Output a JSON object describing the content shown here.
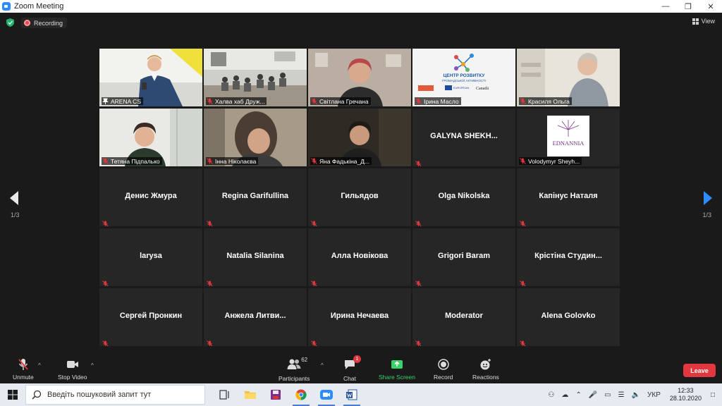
{
  "window": {
    "title": "Zoom Meeting",
    "minimize": "—",
    "restore": "❐",
    "close": "✕"
  },
  "meeting": {
    "recording_label": "Recording",
    "view_label": "View",
    "page_indicator": "1/3"
  },
  "video_tiles": [
    {
      "name": "ARENA CS",
      "has_video": true,
      "active": true
    },
    {
      "name": "Халва хаб Друж...",
      "has_video": true
    },
    {
      "name": "Світлана Гречана",
      "has_video": true
    },
    {
      "name": "Ірина Масло",
      "has_video": true
    },
    {
      "name": "Красиля Ольга",
      "has_video": true
    },
    {
      "name": "Тетяна Підпалько",
      "has_video": true
    },
    {
      "name": "Інна Ніколаєва",
      "has_video": true
    },
    {
      "name": "Яна Фадькіна_Д...",
      "has_video": true
    },
    {
      "name": "GALYNA  SHEKH...",
      "has_video": false
    },
    {
      "name": "Volodymyr Sheyh...",
      "has_video": true,
      "logo": "EDNANNIA"
    }
  ],
  "name_tiles": [
    "Денис Жмура",
    "Regina Garifullina",
    "Гильядов",
    "Olga Nikolska",
    "Капінус Наталя",
    "larysa",
    "Natalia Silanina",
    "Алла Новікова",
    "Grigori Baram",
    "Крістіна  Студин...",
    "Сергей Пронкин",
    "Анжела  Литви...",
    "Ирина Нечаева",
    "Moderator",
    "Alena Golovko"
  ],
  "scene_text": {
    "banner_line1": "ЦЕНТР РОЗВИТКУ",
    "banner_line2": "ГРОМАДСЬКОЇ АКТИВНОСТІ",
    "banner_sponsor1": "EUROPEAN",
    "banner_sponsor2": "Canadä"
  },
  "toolbar": {
    "unmute": "Unmute",
    "stop_video": "Stop Video",
    "participants": "Participants",
    "participants_count": "62",
    "chat": "Chat",
    "chat_badge": "1",
    "share_screen": "Share Screen",
    "record": "Record",
    "reactions": "Reactions",
    "leave": "Leave",
    "caret": "^"
  },
  "taskbar": {
    "search_placeholder": "Введіть пошуковий запит тут",
    "language": "УКР",
    "time": "12:33",
    "date": "28.10.2020"
  },
  "colors": {
    "accent_blue": "#2d8cff",
    "leave_red": "#e0383e",
    "share_green": "#3ad36b",
    "active_speaker": "#f5e33a"
  }
}
